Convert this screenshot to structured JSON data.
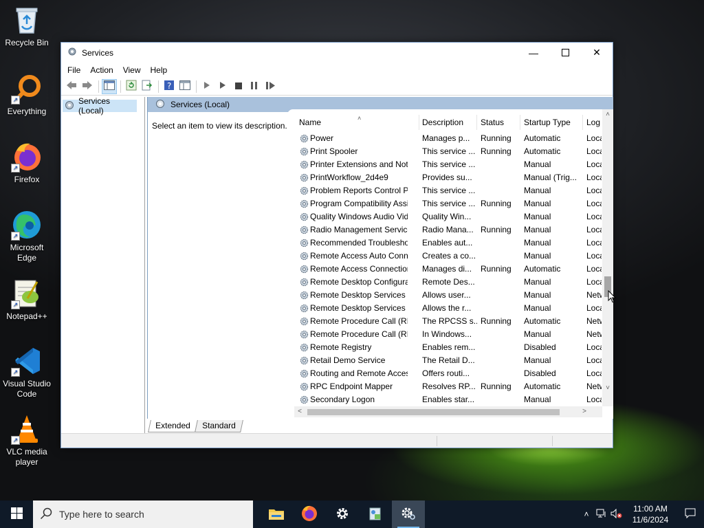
{
  "desktop": {
    "icons": [
      {
        "label": "Recycle Bin",
        "icon": "recycle-bin-icon"
      },
      {
        "label": "Everything",
        "icon": "everything-search-icon"
      },
      {
        "label": "Firefox",
        "icon": "firefox-icon"
      },
      {
        "label": "Microsoft Edge",
        "icon": "edge-icon"
      },
      {
        "label": "Notepad++",
        "icon": "notepadpp-icon"
      },
      {
        "label": "Visual Studio Code",
        "icon": "vscode-icon"
      },
      {
        "label": "VLC media player",
        "icon": "vlc-icon"
      }
    ]
  },
  "window": {
    "title": "Services",
    "menu": [
      "File",
      "Action",
      "View",
      "Help"
    ],
    "tree_item": "Services (Local)",
    "header_title": "Services (Local)",
    "description_prompt": "Select an item to view its description.",
    "columns": {
      "name": "Name",
      "description": "Description",
      "status": "Status",
      "startup": "Startup Type",
      "logon": "Log"
    },
    "services": [
      {
        "name": "Power",
        "description": "Manages p...",
        "status": "Running",
        "startup": "Automatic",
        "logon": "Loca"
      },
      {
        "name": "Print Spooler",
        "description": "This service ...",
        "status": "Running",
        "startup": "Automatic",
        "logon": "Loca"
      },
      {
        "name": "Printer Extensions and Notif...",
        "description": "This service ...",
        "status": "",
        "startup": "Manual",
        "logon": "Loca"
      },
      {
        "name": "PrintWorkflow_2d4e9",
        "description": "Provides su...",
        "status": "",
        "startup": "Manual (Trig...",
        "logon": "Loca"
      },
      {
        "name": "Problem Reports Control Pa...",
        "description": "This service ...",
        "status": "",
        "startup": "Manual",
        "logon": "Loca"
      },
      {
        "name": "Program Compatibility Assi...",
        "description": "This service ...",
        "status": "Running",
        "startup": "Manual",
        "logon": "Loca"
      },
      {
        "name": "Quality Windows Audio Vid...",
        "description": "Quality Win...",
        "status": "",
        "startup": "Manual",
        "logon": "Loca"
      },
      {
        "name": "Radio Management Service",
        "description": "Radio Mana...",
        "status": "Running",
        "startup": "Manual",
        "logon": "Loca"
      },
      {
        "name": "Recommended Troublesho...",
        "description": "Enables aut...",
        "status": "",
        "startup": "Manual",
        "logon": "Loca"
      },
      {
        "name": "Remote Access Auto Conne...",
        "description": "Creates a co...",
        "status": "",
        "startup": "Manual",
        "logon": "Loca"
      },
      {
        "name": "Remote Access Connection...",
        "description": "Manages di...",
        "status": "Running",
        "startup": "Automatic",
        "logon": "Loca"
      },
      {
        "name": "Remote Desktop Configurat...",
        "description": "Remote Des...",
        "status": "",
        "startup": "Manual",
        "logon": "Loca"
      },
      {
        "name": "Remote Desktop Services",
        "description": "Allows user...",
        "status": "",
        "startup": "Manual",
        "logon": "Netw"
      },
      {
        "name": "Remote Desktop Services U...",
        "description": "Allows the r...",
        "status": "",
        "startup": "Manual",
        "logon": "Loca"
      },
      {
        "name": "Remote Procedure Call (RPC)",
        "description": "The RPCSS s...",
        "status": "Running",
        "startup": "Automatic",
        "logon": "Netw"
      },
      {
        "name": "Remote Procedure Call (RP...",
        "description": "In Windows...",
        "status": "",
        "startup": "Manual",
        "logon": "Netw"
      },
      {
        "name": "Remote Registry",
        "description": "Enables rem...",
        "status": "",
        "startup": "Disabled",
        "logon": "Loca"
      },
      {
        "name": "Retail Demo Service",
        "description": "The Retail D...",
        "status": "",
        "startup": "Manual",
        "logon": "Loca"
      },
      {
        "name": "Routing and Remote Access",
        "description": "Offers routi...",
        "status": "",
        "startup": "Disabled",
        "logon": "Loca"
      },
      {
        "name": "RPC Endpoint Mapper",
        "description": "Resolves RP...",
        "status": "Running",
        "startup": "Automatic",
        "logon": "Netw"
      },
      {
        "name": "Secondary Logon",
        "description": "Enables star...",
        "status": "",
        "startup": "Manual",
        "logon": "Loca"
      }
    ],
    "tabs": [
      "Extended",
      "Standard"
    ]
  },
  "taskbar": {
    "search_placeholder": "Type here to search",
    "time": "11:00 AM",
    "date": "11/6/2024"
  }
}
